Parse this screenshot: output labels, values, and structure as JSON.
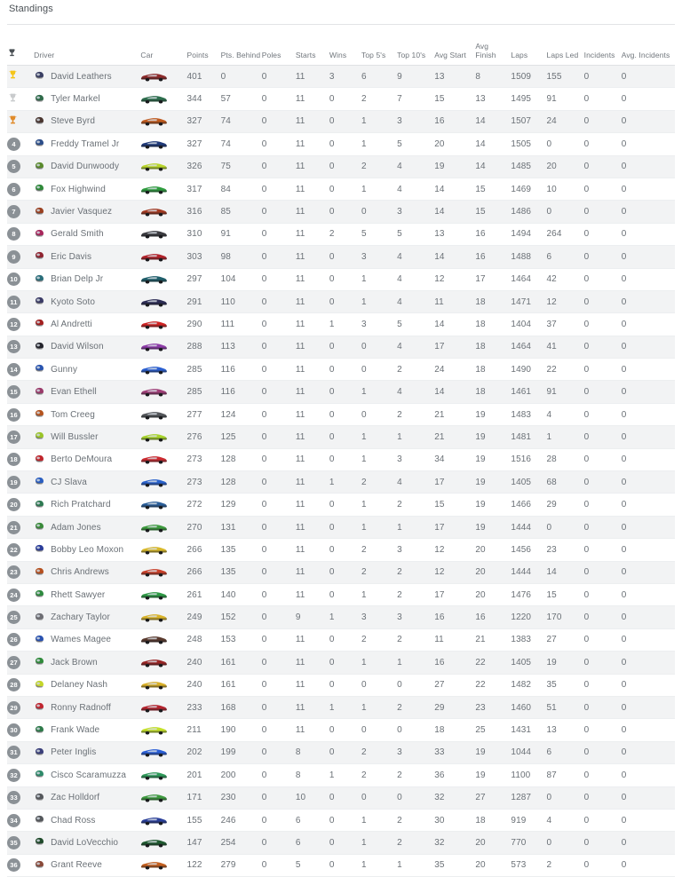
{
  "page": {
    "title": "Standings"
  },
  "table": {
    "columns": [
      {
        "key": "rank",
        "label": "",
        "icon": "trophy-icon"
      },
      {
        "key": "driver",
        "label": "Driver"
      },
      {
        "key": "car",
        "label": "Car"
      },
      {
        "key": "points",
        "label": "Points"
      },
      {
        "key": "behind",
        "label": "Pts. Behind"
      },
      {
        "key": "poles",
        "label": "Poles"
      },
      {
        "key": "starts",
        "label": "Starts"
      },
      {
        "key": "wins",
        "label": "Wins"
      },
      {
        "key": "top5",
        "label": "Top 5's"
      },
      {
        "key": "top10",
        "label": "Top 10's"
      },
      {
        "key": "avg_start",
        "label": "Avg Start"
      },
      {
        "key": "avg_finish",
        "label": "Avg Finish"
      },
      {
        "key": "laps",
        "label": "Laps"
      },
      {
        "key": "laps_led",
        "label": "Laps Led"
      },
      {
        "key": "incidents",
        "label": "Incidents"
      },
      {
        "key": "avg_incidents",
        "label": "Avg. Incidents"
      }
    ],
    "medal_colors": {
      "gold": "#f5c518",
      "silver": "#c9cbcd",
      "bronze": "#e08b2a"
    },
    "badge_color": "#8b9196",
    "rows": [
      {
        "rank": 1,
        "medal": "gold",
        "driver": "David Leathers",
        "helmet": "#3a3f63",
        "car": "#8e2b2b",
        "points": 401,
        "behind": 0,
        "poles": 0,
        "starts": 11,
        "wins": 3,
        "top5": 6,
        "top10": 9,
        "avg_start": 13,
        "avg_finish": 8,
        "laps": 1509,
        "laps_led": 155,
        "incidents": 0,
        "avg_incidents": 0
      },
      {
        "rank": 2,
        "medal": "silver",
        "driver": "Tyler Markel",
        "helmet": "#2f6b4a",
        "car": "#2e6f4e",
        "points": 344,
        "behind": 57,
        "poles": 0,
        "starts": 11,
        "wins": 0,
        "top5": 2,
        "top10": 7,
        "avg_start": 15,
        "avg_finish": 13,
        "laps": 1495,
        "laps_led": 91,
        "incidents": 0,
        "avg_incidents": 0
      },
      {
        "rank": 3,
        "medal": "bronze",
        "driver": "Steve Byrd",
        "helmet": "#4a3630",
        "car": "#c05a1e",
        "points": 327,
        "behind": 74,
        "poles": 0,
        "starts": 11,
        "wins": 0,
        "top5": 1,
        "top10": 3,
        "avg_start": 16,
        "avg_finish": 14,
        "laps": 1507,
        "laps_led": 24,
        "incidents": 0,
        "avg_incidents": 0
      },
      {
        "rank": 4,
        "medal": "",
        "driver": "Freddy Tramel Jr",
        "helmet": "#2c4e8a",
        "car": "#203a7a",
        "points": 327,
        "behind": 74,
        "poles": 0,
        "starts": 11,
        "wins": 0,
        "top5": 1,
        "top10": 5,
        "avg_start": 20,
        "avg_finish": 14,
        "laps": 1505,
        "laps_led": 0,
        "incidents": 0,
        "avg_incidents": 0
      },
      {
        "rank": 5,
        "medal": "",
        "driver": "David Dunwoody",
        "helmet": "#5a8a2c",
        "car": "#b9d62a",
        "points": 326,
        "behind": 75,
        "poles": 0,
        "starts": 11,
        "wins": 0,
        "top5": 2,
        "top10": 4,
        "avg_start": 19,
        "avg_finish": 14,
        "laps": 1485,
        "laps_led": 20,
        "incidents": 0,
        "avg_incidents": 0
      },
      {
        "rank": 6,
        "medal": "",
        "driver": "Fox Highwind",
        "helmet": "#2f8a3a",
        "car": "#2f9c3e",
        "points": 317,
        "behind": 84,
        "poles": 0,
        "starts": 11,
        "wins": 0,
        "top5": 1,
        "top10": 4,
        "avg_start": 14,
        "avg_finish": 15,
        "laps": 1469,
        "laps_led": 10,
        "incidents": 0,
        "avg_incidents": 0
      },
      {
        "rank": 7,
        "medal": "",
        "driver": "Javier Vasquez",
        "helmet": "#9a4020",
        "car": "#a33a22",
        "points": 316,
        "behind": 85,
        "poles": 0,
        "starts": 11,
        "wins": 0,
        "top5": 0,
        "top10": 3,
        "avg_start": 14,
        "avg_finish": 15,
        "laps": 1486,
        "laps_led": 0,
        "incidents": 0,
        "avg_incidents": 0
      },
      {
        "rank": 8,
        "medal": "",
        "driver": "Gerald Smith",
        "helmet": "#a8275c",
        "car": "#3d3d42",
        "points": 310,
        "behind": 91,
        "poles": 0,
        "starts": 11,
        "wins": 2,
        "top5": 5,
        "top10": 5,
        "avg_start": 13,
        "avg_finish": 16,
        "laps": 1494,
        "laps_led": 264,
        "incidents": 0,
        "avg_incidents": 0
      },
      {
        "rank": 9,
        "medal": "",
        "driver": "Eric Davis",
        "helmet": "#8f2430",
        "car": "#b3232b",
        "points": 303,
        "behind": 98,
        "poles": 0,
        "starts": 11,
        "wins": 0,
        "top5": 3,
        "top10": 4,
        "avg_start": 14,
        "avg_finish": 16,
        "laps": 1488,
        "laps_led": 6,
        "incidents": 0,
        "avg_incidents": 0
      },
      {
        "rank": 10,
        "medal": "",
        "driver": "Brian Delp Jr",
        "helmet": "#2a6e7a",
        "car": "#1f5f6b",
        "points": 297,
        "behind": 104,
        "poles": 0,
        "starts": 11,
        "wins": 0,
        "top5": 1,
        "top10": 4,
        "avg_start": 12,
        "avg_finish": 17,
        "laps": 1464,
        "laps_led": 42,
        "incidents": 0,
        "avg_incidents": 0
      },
      {
        "rank": 11,
        "medal": "",
        "driver": "Kyoto Soto",
        "helmet": "#3b3b66",
        "car": "#2c2c55",
        "points": 291,
        "behind": 110,
        "poles": 0,
        "starts": 11,
        "wins": 0,
        "top5": 1,
        "top10": 4,
        "avg_start": 11,
        "avg_finish": 18,
        "laps": 1471,
        "laps_led": 12,
        "incidents": 0,
        "avg_incidents": 0
      },
      {
        "rank": 12,
        "medal": "",
        "driver": "Al Andretti",
        "helmet": "#a32020",
        "car": "#cf2323",
        "points": 290,
        "behind": 111,
        "poles": 0,
        "starts": 11,
        "wins": 1,
        "top5": 3,
        "top10": 5,
        "avg_start": 14,
        "avg_finish": 18,
        "laps": 1404,
        "laps_led": 37,
        "incidents": 0,
        "avg_incidents": 0
      },
      {
        "rank": 13,
        "medal": "",
        "driver": "David Wilson",
        "helmet": "#23232b",
        "car": "#8e3ba8",
        "points": 288,
        "behind": 113,
        "poles": 0,
        "starts": 11,
        "wins": 0,
        "top5": 0,
        "top10": 4,
        "avg_start": 17,
        "avg_finish": 18,
        "laps": 1464,
        "laps_led": 41,
        "incidents": 0,
        "avg_incidents": 0
      },
      {
        "rank": 14,
        "medal": "",
        "driver": "Gunny",
        "helmet": "#2a55b0",
        "car": "#2b5fd0",
        "points": 285,
        "behind": 116,
        "poles": 0,
        "starts": 11,
        "wins": 0,
        "top5": 0,
        "top10": 2,
        "avg_start": 24,
        "avg_finish": 18,
        "laps": 1490,
        "laps_led": 22,
        "incidents": 0,
        "avg_incidents": 0
      },
      {
        "rank": 15,
        "medal": "",
        "driver": "Evan Ethell",
        "helmet": "#9a3a6a",
        "car": "#a03f78",
        "points": 285,
        "behind": 116,
        "poles": 0,
        "starts": 11,
        "wins": 0,
        "top5": 1,
        "top10": 4,
        "avg_start": 14,
        "avg_finish": 18,
        "laps": 1461,
        "laps_led": 91,
        "incidents": 0,
        "avg_incidents": 0
      },
      {
        "rank": 16,
        "medal": "",
        "driver": "Tom Creeg",
        "helmet": "#b5541f",
        "car": "#55585c",
        "points": 277,
        "behind": 124,
        "poles": 0,
        "starts": 11,
        "wins": 0,
        "top5": 0,
        "top10": 2,
        "avg_start": 21,
        "avg_finish": 19,
        "laps": 1483,
        "laps_led": 4,
        "incidents": 0,
        "avg_incidents": 0
      },
      {
        "rank": 17,
        "medal": "",
        "driver": "Will Bussler",
        "helmet": "#9ac428",
        "car": "#a8d42c",
        "points": 276,
        "behind": 125,
        "poles": 0,
        "starts": 11,
        "wins": 0,
        "top5": 1,
        "top10": 1,
        "avg_start": 21,
        "avg_finish": 19,
        "laps": 1481,
        "laps_led": 1,
        "incidents": 0,
        "avg_incidents": 0
      },
      {
        "rank": 18,
        "medal": "",
        "driver": "Berto DeMoura",
        "helmet": "#c0262c",
        "car": "#cc2a30",
        "points": 273,
        "behind": 128,
        "poles": 0,
        "starts": 11,
        "wins": 0,
        "top5": 1,
        "top10": 3,
        "avg_start": 34,
        "avg_finish": 19,
        "laps": 1516,
        "laps_led": 28,
        "incidents": 0,
        "avg_incidents": 0
      },
      {
        "rank": 19,
        "medal": "",
        "driver": "CJ Slava",
        "helmet": "#2a5ec0",
        "car": "#2a62cc",
        "points": 273,
        "behind": 128,
        "poles": 0,
        "starts": 11,
        "wins": 1,
        "top5": 2,
        "top10": 4,
        "avg_start": 17,
        "avg_finish": 19,
        "laps": 1405,
        "laps_led": 68,
        "incidents": 0,
        "avg_incidents": 0
      },
      {
        "rank": 20,
        "medal": "",
        "driver": "Rich Pratchard",
        "helmet": "#2f7a52",
        "car": "#2b5f9a",
        "points": 272,
        "behind": 129,
        "poles": 0,
        "starts": 11,
        "wins": 0,
        "top5": 1,
        "top10": 2,
        "avg_start": 15,
        "avg_finish": 19,
        "laps": 1466,
        "laps_led": 29,
        "incidents": 0,
        "avg_incidents": 0
      },
      {
        "rank": 21,
        "medal": "",
        "driver": "Adam Jones",
        "helmet": "#3a8a3a",
        "car": "#3f9c3f",
        "points": 270,
        "behind": 131,
        "poles": 0,
        "starts": 11,
        "wins": 0,
        "top5": 1,
        "top10": 1,
        "avg_start": 17,
        "avg_finish": 19,
        "laps": 1444,
        "laps_led": 0,
        "incidents": 0,
        "avg_incidents": 0
      },
      {
        "rank": 22,
        "medal": "",
        "driver": "Bobby Leo Moxon",
        "helmet": "#2b3d9a",
        "car": "#d8b82a",
        "points": 266,
        "behind": 135,
        "poles": 0,
        "starts": 11,
        "wins": 0,
        "top5": 2,
        "top10": 3,
        "avg_start": 12,
        "avg_finish": 20,
        "laps": 1456,
        "laps_led": 23,
        "incidents": 0,
        "avg_incidents": 0
      },
      {
        "rank": 23,
        "medal": "",
        "driver": "Chris Andrews",
        "helmet": "#b5501f",
        "car": "#c9402a",
        "points": 266,
        "behind": 135,
        "poles": 0,
        "starts": 11,
        "wins": 0,
        "top5": 2,
        "top10": 2,
        "avg_start": 12,
        "avg_finish": 20,
        "laps": 1444,
        "laps_led": 14,
        "incidents": 0,
        "avg_incidents": 0
      },
      {
        "rank": 24,
        "medal": "",
        "driver": "Rhett Sawyer",
        "helmet": "#2f8a3f",
        "car": "#2f9a46",
        "points": 261,
        "behind": 140,
        "poles": 0,
        "starts": 11,
        "wins": 0,
        "top5": 1,
        "top10": 2,
        "avg_start": 17,
        "avg_finish": 20,
        "laps": 1476,
        "laps_led": 15,
        "incidents": 0,
        "avg_incidents": 0
      },
      {
        "rank": 25,
        "medal": "",
        "driver": "Zachary Taylor",
        "helmet": "#6e6e74",
        "car": "#d9b32a",
        "points": 249,
        "behind": 152,
        "poles": 0,
        "starts": 9,
        "wins": 1,
        "top5": 3,
        "top10": 3,
        "avg_start": 16,
        "avg_finish": 16,
        "laps": 1220,
        "laps_led": 170,
        "incidents": 0,
        "avg_incidents": 0
      },
      {
        "rank": 26,
        "medal": "",
        "driver": "Wames Magee",
        "helmet": "#2a52b0",
        "car": "#5a3a2e",
        "points": 248,
        "behind": 153,
        "poles": 0,
        "starts": 11,
        "wins": 0,
        "top5": 2,
        "top10": 2,
        "avg_start": 11,
        "avg_finish": 21,
        "laps": 1383,
        "laps_led": 27,
        "incidents": 0,
        "avg_incidents": 0
      },
      {
        "rank": 27,
        "medal": "",
        "driver": "Jack Brown",
        "helmet": "#2f8a3a",
        "car": "#9a2626",
        "points": 240,
        "behind": 161,
        "poles": 0,
        "starts": 11,
        "wins": 0,
        "top5": 1,
        "top10": 1,
        "avg_start": 16,
        "avg_finish": 22,
        "laps": 1405,
        "laps_led": 19,
        "incidents": 0,
        "avg_incidents": 0
      },
      {
        "rank": 28,
        "medal": "",
        "driver": "Delaney Nash",
        "helmet": "#c4d62a",
        "car": "#d9b02a",
        "points": 240,
        "behind": 161,
        "poles": 0,
        "starts": 11,
        "wins": 0,
        "top5": 0,
        "top10": 0,
        "avg_start": 27,
        "avg_finish": 22,
        "laps": 1482,
        "laps_led": 35,
        "incidents": 0,
        "avg_incidents": 0
      },
      {
        "rank": 29,
        "medal": "",
        "driver": "Ronny Radnoff",
        "helmet": "#c02630",
        "car": "#b5252f",
        "points": 233,
        "behind": 168,
        "poles": 0,
        "starts": 11,
        "wins": 1,
        "top5": 1,
        "top10": 2,
        "avg_start": 29,
        "avg_finish": 23,
        "laps": 1460,
        "laps_led": 51,
        "incidents": 0,
        "avg_incidents": 0
      },
      {
        "rank": 30,
        "medal": "",
        "driver": "Frank Wade",
        "helmet": "#2f7a4a",
        "car": "#c4e02a",
        "points": 211,
        "behind": 190,
        "poles": 0,
        "starts": 11,
        "wins": 0,
        "top5": 0,
        "top10": 0,
        "avg_start": 18,
        "avg_finish": 25,
        "laps": 1431,
        "laps_led": 13,
        "incidents": 0,
        "avg_incidents": 0
      },
      {
        "rank": 31,
        "medal": "",
        "driver": "Peter Inglis",
        "helmet": "#3a3f7a",
        "car": "#2a5ed6",
        "points": 202,
        "behind": 199,
        "poles": 0,
        "starts": 8,
        "wins": 0,
        "top5": 2,
        "top10": 3,
        "avg_start": 33,
        "avg_finish": 19,
        "laps": 1044,
        "laps_led": 6,
        "incidents": 0,
        "avg_incidents": 0
      },
      {
        "rank": 32,
        "medal": "",
        "driver": "Cisco Scaramuzza",
        "helmet": "#2f8a6a",
        "car": "#2f9a5a",
        "points": 201,
        "behind": 200,
        "poles": 0,
        "starts": 8,
        "wins": 1,
        "top5": 2,
        "top10": 2,
        "avg_start": 36,
        "avg_finish": 19,
        "laps": 1100,
        "laps_led": 87,
        "incidents": 0,
        "avg_incidents": 0
      },
      {
        "rank": 33,
        "medal": "",
        "driver": "Zac Holldorf",
        "helmet": "#55585c",
        "car": "#3f9a3f",
        "points": 171,
        "behind": 230,
        "poles": 0,
        "starts": 10,
        "wins": 0,
        "top5": 0,
        "top10": 0,
        "avg_start": 32,
        "avg_finish": 27,
        "laps": 1287,
        "laps_led": 0,
        "incidents": 0,
        "avg_incidents": 0
      },
      {
        "rank": 34,
        "medal": "",
        "driver": "Chad Ross",
        "helmet": "#55585c",
        "car": "#2a3f9a",
        "points": 155,
        "behind": 246,
        "poles": 0,
        "starts": 6,
        "wins": 0,
        "top5": 1,
        "top10": 2,
        "avg_start": 30,
        "avg_finish": 18,
        "laps": 919,
        "laps_led": 4,
        "incidents": 0,
        "avg_incidents": 0
      },
      {
        "rank": 35,
        "medal": "",
        "driver": "David LoVecchio",
        "helmet": "#1f4a2a",
        "car": "#1f5a30",
        "points": 147,
        "behind": 254,
        "poles": 0,
        "starts": 6,
        "wins": 0,
        "top5": 1,
        "top10": 2,
        "avg_start": 32,
        "avg_finish": 20,
        "laps": 770,
        "laps_led": 0,
        "incidents": 0,
        "avg_incidents": 0
      },
      {
        "rank": 36,
        "medal": "",
        "driver": "Grant Reeve",
        "helmet": "#8a4a3a",
        "car": "#c4601f",
        "points": 122,
        "behind": 279,
        "poles": 0,
        "starts": 5,
        "wins": 0,
        "top5": 1,
        "top10": 1,
        "avg_start": 35,
        "avg_finish": 20,
        "laps": 573,
        "laps_led": 2,
        "incidents": 0,
        "avg_incidents": 0
      }
    ]
  }
}
